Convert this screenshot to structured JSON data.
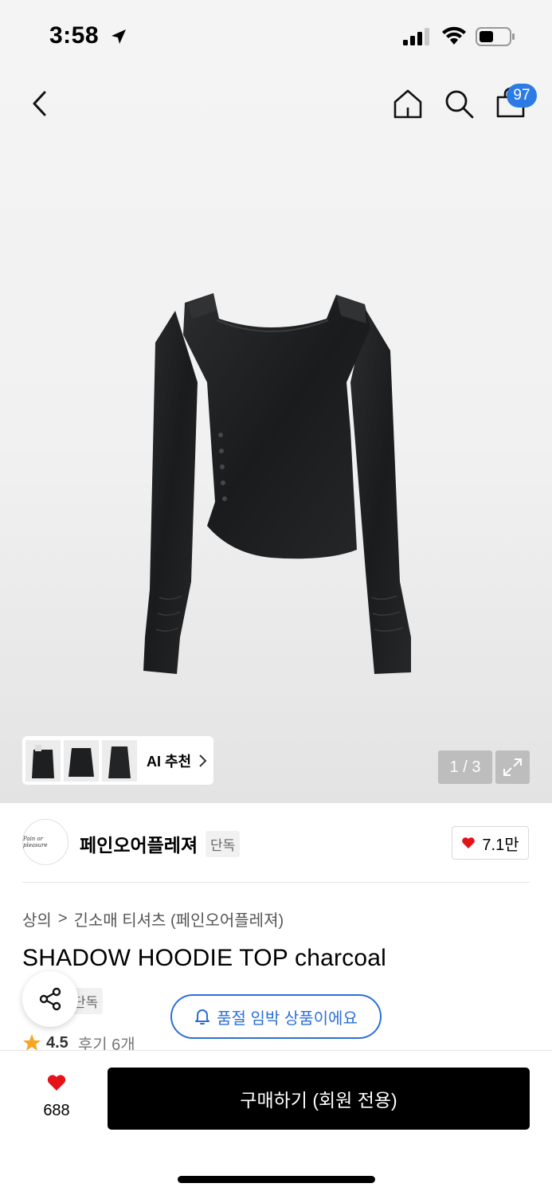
{
  "status_bar": {
    "time": "3:58",
    "location_icon": "location-arrow-icon",
    "signal_icon": "cellular-signal-icon",
    "wifi_icon": "wifi-icon",
    "battery_icon": "battery-icon"
  },
  "nav": {
    "back_icon": "chevron-left-icon",
    "home_icon": "home-icon",
    "search_icon": "search-icon",
    "cart_icon": "shopping-bag-icon",
    "cart_count": "97",
    "accent_color": "#2c7be5"
  },
  "gallery": {
    "ai_label": "AI 추천",
    "page_counter": "1 / 3",
    "expand_icon": "expand-icon"
  },
  "brand": {
    "logo_text": "Pain or pleasure",
    "name": "페인오어플레져",
    "tag": "단독",
    "like_count": "7.1만"
  },
  "breadcrumb": {
    "category": "상의",
    "separator": ">",
    "subcategory": "긴소매 티셔츠 (페인오어플레져)"
  },
  "product": {
    "title": "SHADOW HOODIE TOP charcoal",
    "exclusive_tag": "단독",
    "stock_alert": "품절 임박 상품이에요",
    "rating": "4.5",
    "reviews": "후기 6개"
  },
  "bottom_bar": {
    "wish_count": "688",
    "buy_label": "구매하기 (회원 전용)"
  }
}
